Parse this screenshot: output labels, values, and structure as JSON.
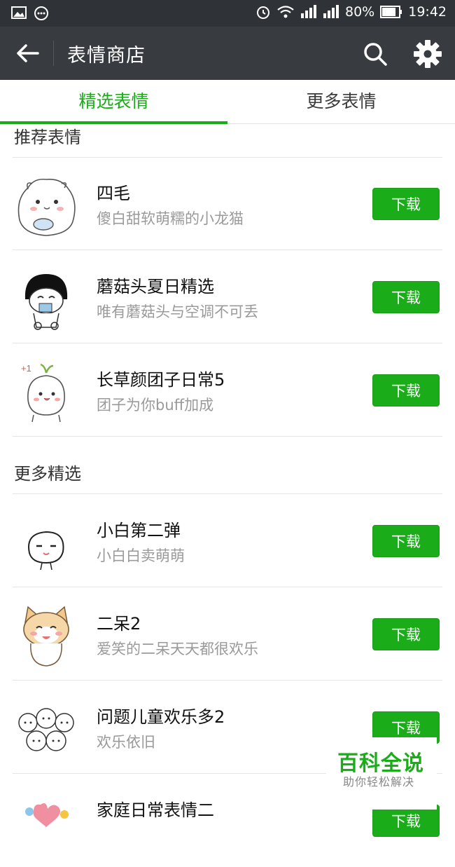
{
  "status_bar": {
    "battery": "80%",
    "time": "19:42",
    "icons": [
      "image-icon",
      "chat-icon",
      "alarm-icon",
      "wifi-icon",
      "signal-icon",
      "signal-icon",
      "battery-icon"
    ]
  },
  "nav": {
    "title": "表情商店",
    "icons": [
      "back-arrow-icon",
      "search-icon",
      "gear-icon"
    ]
  },
  "tabs": [
    {
      "label": "精选表情",
      "active": true
    },
    {
      "label": "更多表情",
      "active": false
    }
  ],
  "colors": {
    "accent": "#1aad19",
    "navbar": "#383b40",
    "statusbar": "#2f3236"
  },
  "sections": [
    {
      "title": "推荐表情",
      "items": [
        {
          "title": "四毛",
          "subtitle": "傻白甜软萌糯的小龙猫",
          "button": "下载"
        },
        {
          "title": "蘑菇头夏日精选",
          "subtitle": "唯有蘑菇头与空调不可丢",
          "button": "下载"
        },
        {
          "title": "长草颜团子日常5",
          "subtitle": "团子为你buff加成",
          "button": "下载"
        }
      ]
    },
    {
      "title": "更多精选",
      "items": [
        {
          "title": "小白第二弹",
          "subtitle": "小白白卖萌萌",
          "button": "下载"
        },
        {
          "title": "二呆2",
          "subtitle": "爱笑的二呆天天都很欢乐",
          "button": "下载"
        },
        {
          "title": "问题儿童欢乐多2",
          "subtitle": "欢乐依旧",
          "button": "下载"
        },
        {
          "title": "家庭日常表情二",
          "subtitle": "",
          "button": "下载"
        }
      ]
    }
  ],
  "thumb_mark": "+1",
  "watermark": {
    "main": "百科全说",
    "sub": "助你轻松解决"
  }
}
